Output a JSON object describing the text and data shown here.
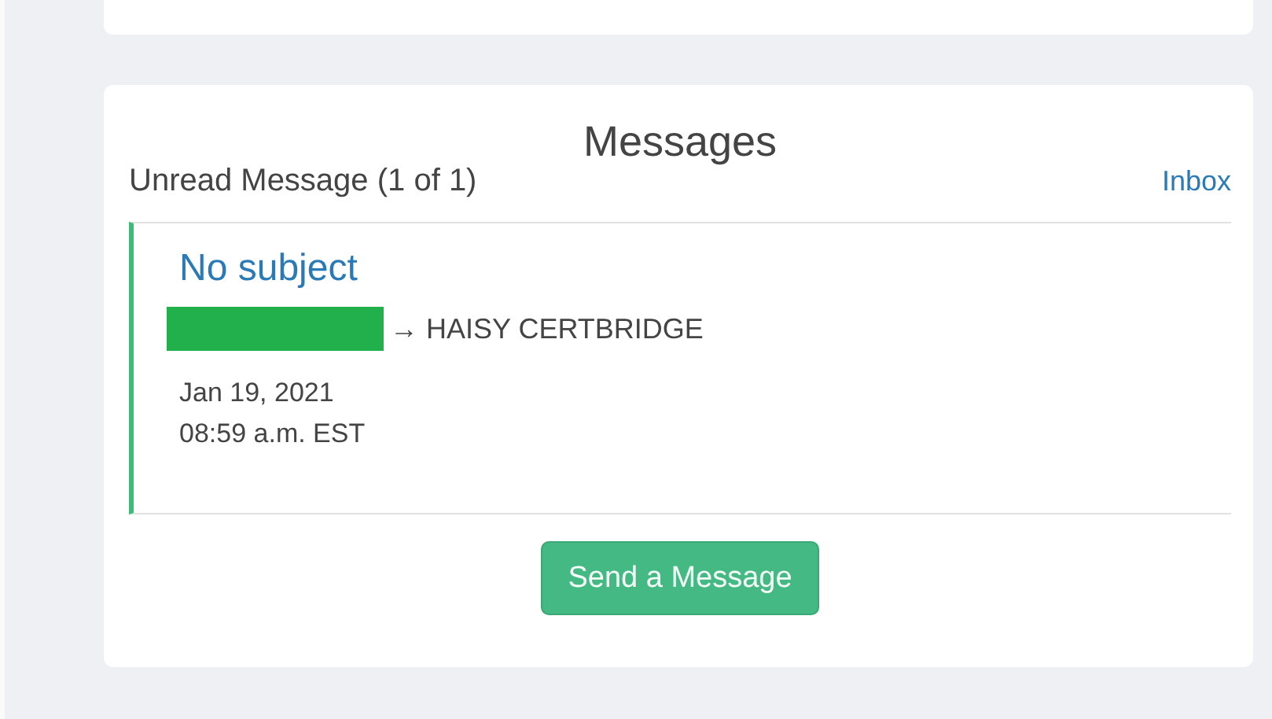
{
  "messages_card": {
    "title": "Messages",
    "unread_label": "Unread Message (1 of 1)",
    "inbox_link": "Inbox",
    "message": {
      "subject": "No subject",
      "sender_redacted": true,
      "recipient": "→ HAISY CERTBRIDGE",
      "date": "Jan 19, 2021",
      "time": "08:59 a.m. EST"
    },
    "send_button": "Send a Message"
  }
}
